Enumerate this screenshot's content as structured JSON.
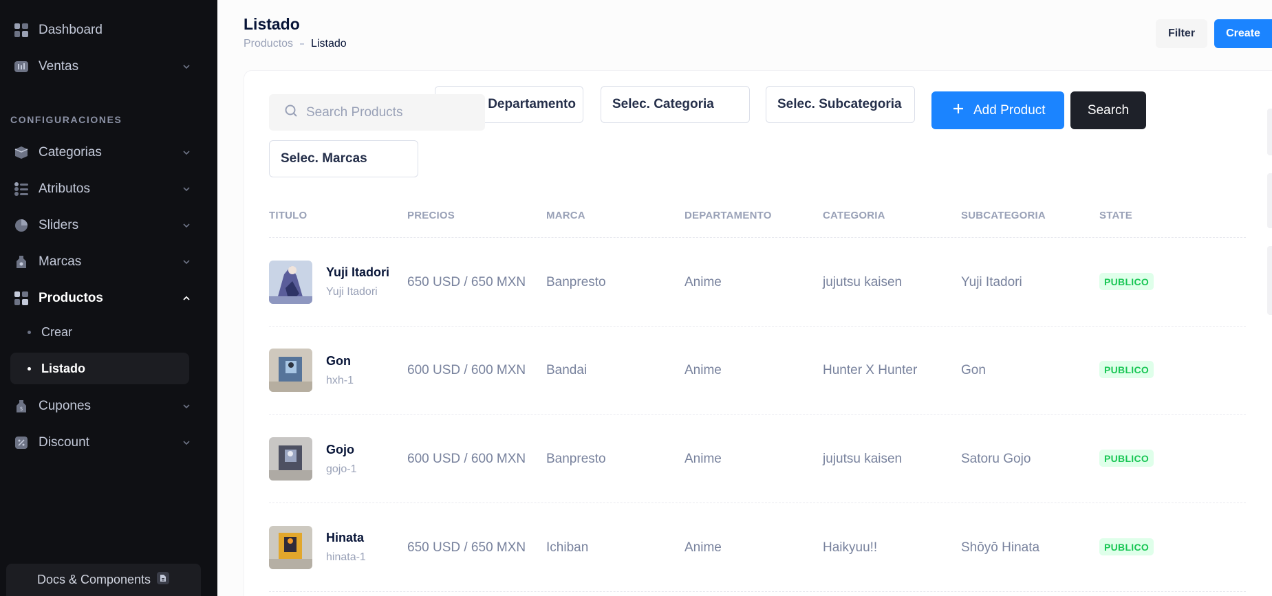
{
  "sidebar": {
    "items": [
      {
        "label": "Dashboard",
        "icon": "dashboard-icon"
      },
      {
        "label": "Ventas",
        "icon": "sales-icon"
      },
      {
        "label": "Categorias",
        "icon": "categories-icon"
      },
      {
        "label": "Atributos",
        "icon": "attributes-icon"
      },
      {
        "label": "Sliders",
        "icon": "sliders-icon"
      },
      {
        "label": "Marcas",
        "icon": "brands-icon"
      },
      {
        "label": "Productos",
        "icon": "products-icon"
      },
      {
        "label": "Cupones",
        "icon": "coupons-icon"
      },
      {
        "label": "Discount",
        "icon": "discount-icon"
      }
    ],
    "section_label": "CONFIGURACIONES",
    "sub_items": [
      {
        "label": "Crear"
      },
      {
        "label": "Listado"
      }
    ],
    "docs_label": "Docs & Components"
  },
  "header": {
    "title": "Listado",
    "breadcrumb": [
      "Productos",
      "Listado"
    ],
    "filter_label": "Filter",
    "create_label": "Create"
  },
  "toolbar": {
    "search_placeholder": "Search Products",
    "select_departamento": "Selec. Departamento",
    "select_categoria": "Selec. Categoria",
    "select_subcategoria": "Selec. Subcategoria",
    "select_marcas": "Selec. Marcas",
    "add_label": "Add Product",
    "search_label": "Search"
  },
  "table": {
    "headers": [
      "TITULO",
      "PRECIOS",
      "MARCA",
      "DEPARTAMENTO",
      "CATEGORIA",
      "SUBCATEGORIA",
      "STATE"
    ],
    "rows": [
      {
        "title": "Yuji Itadori",
        "slug": "Yuji Itadori",
        "price": "650 USD / 650 MXN",
        "brand": "Banpresto",
        "department": "Anime",
        "category": "jujutsu kaisen",
        "subcategory": "Yuji Itadori",
        "state": "PUBLICO"
      },
      {
        "title": "Gon",
        "slug": "hxh-1",
        "price": "600 USD / 600 MXN",
        "brand": "Bandai",
        "department": "Anime",
        "category": "Hunter X Hunter",
        "subcategory": "Gon",
        "state": "PUBLICO"
      },
      {
        "title": "Gojo",
        "slug": "gojo-1",
        "price": "600 USD / 600 MXN",
        "brand": "Banpresto",
        "department": "Anime",
        "category": "jujutsu kaisen",
        "subcategory": "Satoru Gojo",
        "state": "PUBLICO"
      },
      {
        "title": "Hinata",
        "slug": "hinata-1",
        "price": "650 USD / 650 MXN",
        "brand": "Ichiban",
        "department": "Anime",
        "category": "Haikyuu!!",
        "subcategory": "Shōyō Hinata",
        "state": "PUBLICO"
      }
    ]
  },
  "colors": {
    "primary": "#1b84ff",
    "sidebar_bg": "#0f1014",
    "success": "#17c653",
    "success_bg": "#dfffea"
  }
}
